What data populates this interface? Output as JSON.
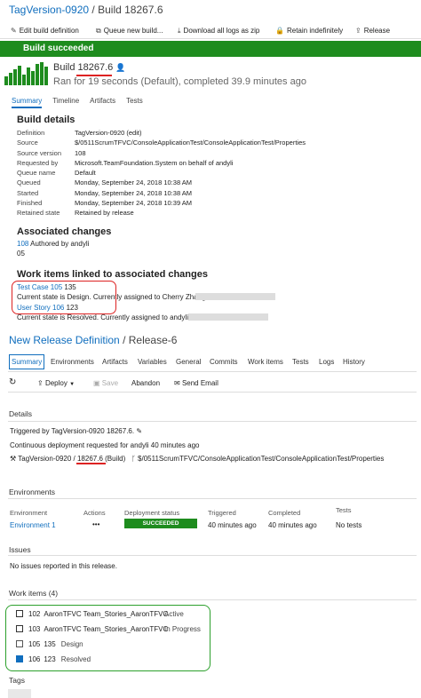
{
  "header": {
    "definition": "TagVersion-0920",
    "separator": " / ",
    "build": "Build 18267.6"
  },
  "toolbar": {
    "edit": "Edit build definition",
    "queue": "Queue new build...",
    "download": "Download all logs as zip",
    "retain": "Retain indefinitely",
    "release": "Release"
  },
  "banner": "Build succeeded",
  "build": {
    "label": "Build ",
    "number": "18267.6",
    "summary": "Ran for 19 seconds (Default), completed 39.9 minutes ago"
  },
  "tabs": [
    "Summary",
    "Timeline",
    "Artifacts",
    "Tests"
  ],
  "build_details": {
    "title": "Build details",
    "rows": [
      {
        "k": "Definition",
        "v": "TagVersion-0920 (edit)",
        "link": true
      },
      {
        "k": "Source",
        "v": "$/0511ScrumTFVC/ConsoleApplicationTest/ConsoleApplicationTest/Properties",
        "link": true
      },
      {
        "k": "Source version",
        "v": "108",
        "link": true
      },
      {
        "k": "Requested by",
        "v": "Microsoft.TeamFoundation.System on behalf of andyli",
        "link": false
      },
      {
        "k": "Queue name",
        "v": "Default",
        "link": true
      },
      {
        "k": "Queued",
        "v": "Monday, September 24, 2018 10:38 AM",
        "link": false
      },
      {
        "k": "Started",
        "v": "Monday, September 24, 2018 10:38 AM",
        "link": false
      },
      {
        "k": "Finished",
        "v": "Monday, September 24, 2018 10:39 AM",
        "link": false
      },
      {
        "k": "Retained state",
        "v": "Retained by release",
        "link": false
      }
    ]
  },
  "associated_changes": {
    "title": "Associated changes",
    "cs_id": "108",
    "cs_text": " Authored by andyli",
    "cs_rev": "05"
  },
  "linked_work_items": {
    "title": "Work items linked to associated changes",
    "items": [
      {
        "link": "Test Case 105",
        "num": " 135",
        "state": "Current state is Design. Currently assigned to Cherry Zhang"
      },
      {
        "link": "User Story 106",
        "num": " 123",
        "state": "Current state is Resolved. Currently assigned to andyli"
      }
    ]
  },
  "release": {
    "definition": "New Release Definition",
    "separator": " / ",
    "name": "Release-6"
  },
  "release_tabs": [
    "Summary",
    "Environments",
    "Artifacts",
    "Variables",
    "General",
    "Commits",
    "Work items",
    "Tests",
    "Logs",
    "History"
  ],
  "release_toolbar": {
    "deploy": "Deploy",
    "save": "Save",
    "abandon": "Abandon",
    "send_email": "Send Email"
  },
  "details": {
    "title": "Details",
    "triggered": "Triggered by TagVersion-0920 18267.6.",
    "cd": "Continuous deployment requested for andyli 40 minutes ago",
    "artifact": "TagVersion-0920 / ",
    "artifact_build": "18267.6",
    "artifact_suffix": " (Build)",
    "artifact_path": "$/0511ScrumTFVC/ConsoleApplicationTest/ConsoleApplicationTest/Properties"
  },
  "environments": {
    "title": "Environments",
    "headers": [
      "Environment",
      "Actions",
      "Deployment status",
      "Triggered",
      "Completed",
      "Tests"
    ],
    "row": {
      "name": "Environment 1",
      "actions": "•••",
      "status": "SUCCEEDED",
      "triggered": "40 minutes ago",
      "completed": "40 minutes ago",
      "tests": "No tests"
    }
  },
  "issues": {
    "title": "Issues",
    "text": "No issues reported in this release."
  },
  "work_items": {
    "title": "Work items (4)",
    "items": [
      {
        "id": "102",
        "title": "AaronTFVC Team_Stories_AaronTFVC",
        "state": "Active",
        "icon": "story-icon"
      },
      {
        "id": "103",
        "title": "AaronTFVC Team_Stories_AaronTFVC",
        "state": "In Progress",
        "icon": "story-icon"
      },
      {
        "id": "105",
        "title": "135",
        "sub": "Design",
        "icon": "test-case-icon"
      },
      {
        "id": "106",
        "title": "123",
        "sub": "Resolved",
        "icon": "user-story-icon"
      }
    ]
  },
  "tags": {
    "title": "Tags"
  },
  "colors": {
    "success": "#1e8c1e",
    "link": "#106ebe",
    "highlight_red": "#dd2222",
    "highlight_green": "#2ca02c"
  }
}
